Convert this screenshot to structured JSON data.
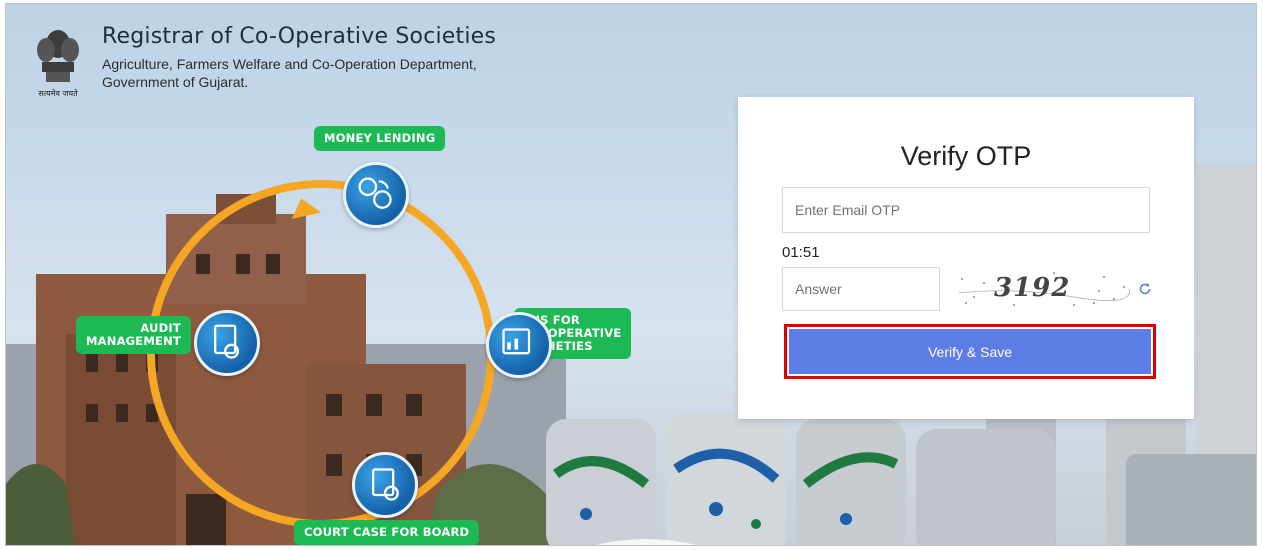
{
  "header": {
    "title": "Registrar of Co-Operative Societies",
    "subtitle_line1": "Agriculture, Farmers Welfare and Co-Operation Department,",
    "subtitle_line2": "Government of Gujarat.",
    "emblem_caption": "सत्यमेव जयते",
    "emblem_icon": "ashoka-emblem-icon"
  },
  "services": {
    "money_lending": "MONEY LENDING",
    "audit_line1": "AUDIT",
    "audit_line2": "MANAGEMENT",
    "mis_line1": "MIS FOR",
    "mis_line2": "CO-OPERATIVE",
    "mis_line3": "SOCIETIES",
    "court_case": "COURT CASE FOR BOARD"
  },
  "otp_form": {
    "title": "Verify OTP",
    "email_otp_placeholder": "Enter Email OTP",
    "timer": "01:51",
    "answer_placeholder": "Answer",
    "captcha_text": "3192",
    "verify_button_label": "Verify & Save",
    "refresh_icon": "refresh-icon"
  },
  "colors": {
    "pill_green": "#1db954",
    "circle_blue": "#1561a8",
    "arrow_orange": "#f5a623",
    "button_blue": "#5b7de5",
    "highlight_red": "#e00000"
  }
}
